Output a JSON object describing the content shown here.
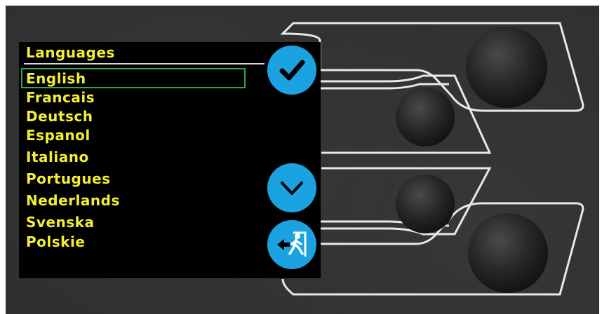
{
  "screen": {
    "title": "Languages",
    "languages": [
      {
        "label": "English",
        "selected": true
      },
      {
        "label": "Francais",
        "selected": false
      },
      {
        "label": "Deutsch",
        "selected": false
      },
      {
        "label": "Espanol",
        "selected": false
      },
      {
        "label": "Italiano",
        "selected": false
      },
      {
        "label": "Portugues",
        "selected": false
      },
      {
        "label": "Nederlands",
        "selected": false
      },
      {
        "label": "Svenska",
        "selected": false
      },
      {
        "label": "Polskie",
        "selected": false
      }
    ]
  },
  "buttons": {
    "confirm_icon": "checkmark-icon",
    "down_icon": "chevron-down-icon",
    "exit_icon": "exit-running-man-icon"
  },
  "colors": {
    "text": "#f3ef2e",
    "accent": "#1aa3e0",
    "highlight": "#2ea84f",
    "screen": "#000000",
    "panel": "#2f2f2f"
  }
}
